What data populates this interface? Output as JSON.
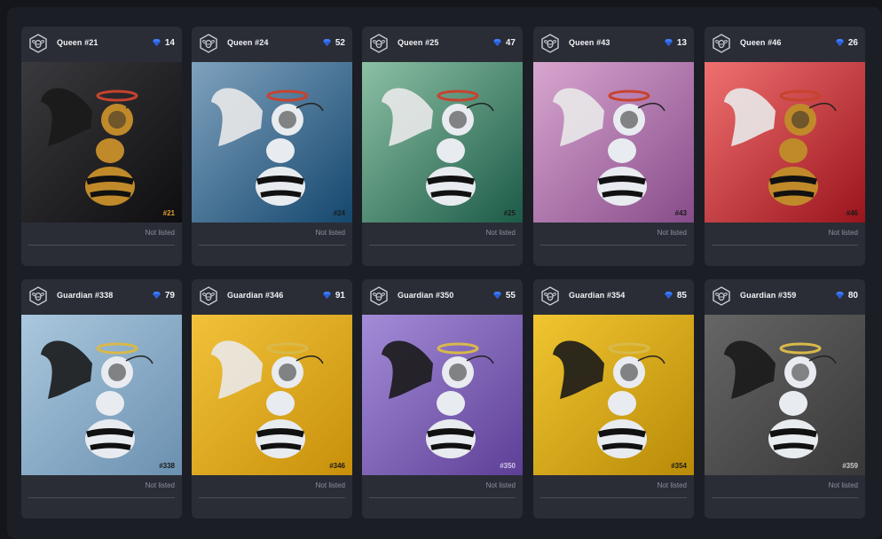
{
  "colors": {
    "page_bg": "#14161c",
    "panel_bg": "#1b1e25",
    "card_bg": "#2a2d35",
    "rank_accent": "#3d7dff",
    "status_text": "#8c919c"
  },
  "icons": {
    "collection": "bee-shield-icon",
    "rank": "diamond-icon"
  },
  "cards": [
    {
      "name": "Queen #21",
      "rank": "14",
      "number": "#21",
      "status": "Not listed",
      "bg_from": "#3a3a3e",
      "bg_to": "#0e0e10",
      "num_color": "#e0a030"
    },
    {
      "name": "Queen #24",
      "rank": "52",
      "number": "#24",
      "status": "Not listed",
      "bg_from": "#7fa2be",
      "bg_to": "#15476e",
      "num_color": "#1a1a1a"
    },
    {
      "name": "Queen #25",
      "rank": "47",
      "number": "#25",
      "status": "Not listed",
      "bg_from": "#8cc0a4",
      "bg_to": "#1c5b48",
      "num_color": "#1a1a1a"
    },
    {
      "name": "Queen #43",
      "rank": "13",
      "number": "#43",
      "status": "Not listed",
      "bg_from": "#d8a6cf",
      "bg_to": "#874c8a",
      "num_color": "#1a1a1a"
    },
    {
      "name": "Queen #46",
      "rank": "26",
      "number": "#46",
      "status": "Not listed",
      "bg_from": "#f07070",
      "bg_to": "#9a141c",
      "num_color": "#1a1a1a"
    },
    {
      "name": "Guardian #338",
      "rank": "79",
      "number": "#338",
      "status": "Not listed",
      "bg_from": "#aac8de",
      "bg_to": "#6b90b0",
      "num_color": "#1a1a1a"
    },
    {
      "name": "Guardian #346",
      "rank": "91",
      "number": "#346",
      "status": "Not listed",
      "bg_from": "#f2c23a",
      "bg_to": "#c8900a",
      "num_color": "#1a1a1a"
    },
    {
      "name": "Guardian #350",
      "rank": "55",
      "number": "#350",
      "status": "Not listed",
      "bg_from": "#a48cd8",
      "bg_to": "#5d3f96",
      "num_color": "#d0c8e8"
    },
    {
      "name": "Guardian #354",
      "rank": "85",
      "number": "#354",
      "status": "Not listed",
      "bg_from": "#f0c530",
      "bg_to": "#b88a08",
      "num_color": "#1a1a1a"
    },
    {
      "name": "Guardian #359",
      "rank": "80",
      "number": "#359",
      "status": "Not listed",
      "bg_from": "#666666",
      "bg_to": "#383838",
      "num_color": "#cccccc"
    }
  ]
}
